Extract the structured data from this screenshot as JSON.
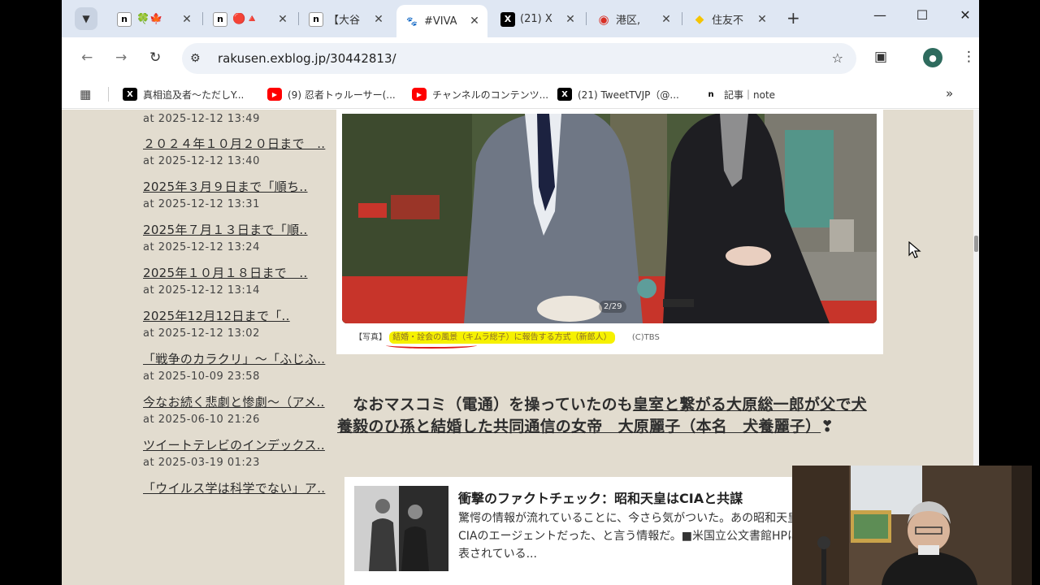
{
  "browser": {
    "tabs": [
      {
        "favicon": "note-icon",
        "fav_text": "n",
        "title": "🍀🍁"
      },
      {
        "favicon": "note-icon",
        "fav_text": "n",
        "title": "🔴🔺"
      },
      {
        "favicon": "note-icon",
        "fav_text": "n",
        "title": "【大谷"
      },
      {
        "favicon": "paw-icon",
        "fav_text": "🐾",
        "title": "#VIVA",
        "active": true
      },
      {
        "favicon": "x-icon",
        "fav_text": "X",
        "title": "(21) X"
      },
      {
        "favicon": "map-pin-icon",
        "fav_text": "◉",
        "title": "港区,"
      },
      {
        "favicon": "yellow-dot-icon",
        "fav_text": "◆",
        "title": "住友不"
      }
    ],
    "tab_close": "✕",
    "new_tab": "+",
    "window_controls": {
      "minimize": "—",
      "maximize": "☐",
      "close": "✕"
    },
    "nav": {
      "back": "←",
      "forward": "→",
      "reload": "↻"
    },
    "url": "rakusen.exblog.jp/30442813/",
    "bookmarks": [
      {
        "icon": "x-icon",
        "fav_text": "X",
        "label": "真相追及者～ただしY..."
      },
      {
        "icon": "youtube-icon",
        "fav_text": "▶",
        "label": "(9) 忍者トゥルーサー(..."
      },
      {
        "icon": "youtube-icon",
        "fav_text": "▶",
        "label": "チャンネルのコンテンツ..."
      },
      {
        "icon": "x-icon",
        "fav_text": "X",
        "label": "(21) TweetTVJP（@..."
      },
      {
        "icon": "note-icon",
        "fav_text": "n",
        "label": "記事｜note"
      }
    ],
    "bookmarks_more": "»"
  },
  "sidebar": {
    "entries": [
      {
        "title": "",
        "date": "at 2025-12-12 13:49"
      },
      {
        "title": "２０２４年１０月２０日まで　..",
        "date": "at 2025-12-12 13:40"
      },
      {
        "title": "2025年３月９日まで「順ち..",
        "date": "at 2025-12-12 13:31"
      },
      {
        "title": "2025年７月１３日まで「順..",
        "date": "at 2025-12-12 13:24"
      },
      {
        "title": "2025年１０月１８日まで　..",
        "date": "at 2025-12-12 13:14"
      },
      {
        "title": "2025年12月12日まで「..",
        "date": "at 2025-12-12 13:02"
      },
      {
        "title": "「戦争のカラクリ」～「ふじふ..",
        "date": "at 2025-10-09 23:58"
      },
      {
        "title": "今なお続く悲劇と惨劇～（アメ..",
        "date": "at 2025-06-10 21:26"
      },
      {
        "title": "ツイートテレビのインデックス..",
        "date": "at 2025-03-19 01:23"
      },
      {
        "title": "「ウイルス学は科学でない」ア..",
        "date": ""
      }
    ]
  },
  "photo": {
    "pager": "2/29",
    "caption_prefix": "【写真】",
    "caption_highlight": "結婚・詮会の風景（キムラ総子）に報告する方式（新郎人）",
    "caption_credit": "(C)TBS"
  },
  "article": {
    "lead": "　なおマスコミ（電通）を操っていたのも",
    "linked": "皇室と繋がる大原総一郎が父で犬養毅のひ孫と結婚した共同通信の女帝　大原麗子（本名　犬養麗子）",
    "tail": "❣"
  },
  "card": {
    "title": "衝撃のファクトチェック：昭和天皇はCIAと共謀",
    "body": "驚愕の情報が流れていることに、今さら気がついた。あの昭和天皇がCIAのエージェントだった、と言う情報だ。■米国立公文書館HPに公表されている..."
  }
}
